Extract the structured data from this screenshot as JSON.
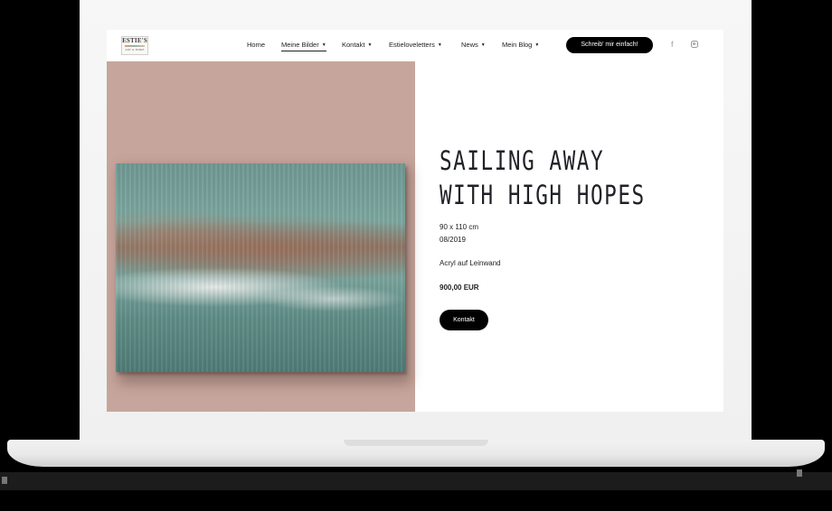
{
  "header": {
    "logo_text": "ESTIE'S",
    "logo_sub": "ART & MORE",
    "nav": [
      {
        "label": "Home",
        "dropdown": false
      },
      {
        "label": "Meine Bilder",
        "dropdown": true,
        "active": true
      },
      {
        "label": "Kontakt",
        "dropdown": true
      },
      {
        "label": "Estieloveletters",
        "dropdown": true
      },
      {
        "label": "News",
        "dropdown": true
      },
      {
        "label": "Mein Blog",
        "dropdown": true
      }
    ],
    "cta_label": "Schreib' mir einfach!",
    "social": [
      {
        "icon": "facebook-icon",
        "glyph": "f"
      },
      {
        "icon": "instagram-icon"
      }
    ]
  },
  "artwork": {
    "title_line1": "SAILING AWAY",
    "title_line2": "WITH HIGH HOPES",
    "size": "90 x 110 cm",
    "date": "08/2019",
    "medium": "Acryl auf Leinwand",
    "price": "900,00 EUR",
    "contact_label": "Kontakt"
  },
  "colors": {
    "panel_background": "#c6a59c",
    "accent": "#000000",
    "painting_teal": "#6f9892"
  }
}
